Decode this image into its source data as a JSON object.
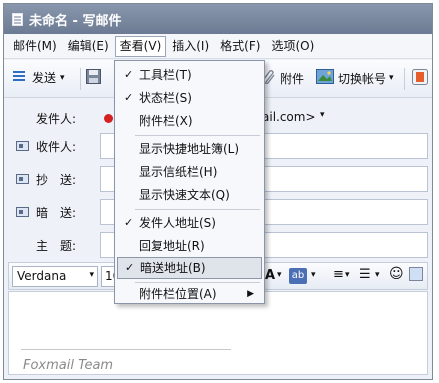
{
  "window": {
    "title": "未命名 - 写邮件"
  },
  "menubar": {
    "items": [
      "邮件(M)",
      "编辑(E)",
      "查看(V)",
      "插入(I)",
      "格式(F)",
      "选项(O)"
    ]
  },
  "toolbar": {
    "send_label": "发送",
    "attach_label": "附件",
    "switch_account_label": "切换帐号"
  },
  "fields": {
    "from_label": "发件人:",
    "from_value": "ail.com>",
    "to_label": "收件人:",
    "cc_label": "抄　送:",
    "bcc_label": "暗　送:",
    "subject_label": "主　题:"
  },
  "formatbar": {
    "font": "Verdana",
    "size": "10"
  },
  "body": {
    "signature": "Foxmail Team"
  },
  "view_menu": {
    "items": [
      {
        "label": "工具栏(T)",
        "checked": "✓"
      },
      {
        "label": "状态栏(S)",
        "checked": "✓"
      },
      {
        "label": "附件栏(X)",
        "checked": ""
      },
      {
        "label": "显示快捷地址簿(L)",
        "checked": ""
      },
      {
        "label": "显示信纸栏(H)",
        "checked": ""
      },
      {
        "label": "显示快速文本(Q)",
        "checked": ""
      },
      {
        "label": "发件人地址(S)",
        "checked": "✓"
      },
      {
        "label": "回复地址(R)",
        "checked": ""
      },
      {
        "label": "暗送地址(B)",
        "checked": "✓"
      },
      {
        "label": "附件栏位置(A)",
        "checked": ""
      }
    ],
    "submenu_arrow": "▶"
  },
  "colors": {
    "titlebar": "#7a879e",
    "highlight": "#dfe3ea",
    "send_icon_blue": "#2f6fc2"
  }
}
